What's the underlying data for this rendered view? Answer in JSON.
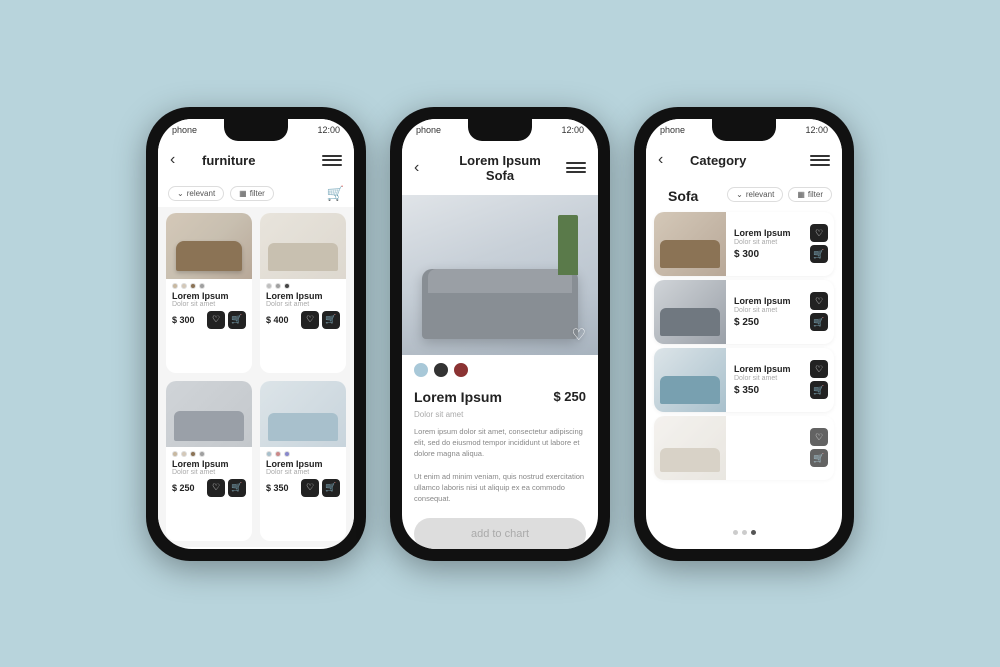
{
  "background": "#b8d4dc",
  "phones": [
    {
      "id": "phone-1",
      "status": {
        "left": "phone",
        "right": "12:00"
      },
      "nav": {
        "title": "furniture",
        "has_back": true,
        "has_menu": true,
        "has_cart": true
      },
      "filters": [
        "relevant",
        "filter"
      ],
      "products": [
        {
          "id": "p1",
          "name": "Lorem Ipsum",
          "sub": "Dolor sit amet",
          "price": "$ 300",
          "colors": [
            "#c8b8a0",
            "#d4c8b8",
            "#8B7355",
            "#a0a0a0"
          ],
          "img_style": "sofa-img-1"
        },
        {
          "id": "p2",
          "name": "Lorem Ipsum",
          "sub": "Dolor sit amet",
          "price": "$ 400",
          "colors": [
            "#c0c0c0",
            "#a0a0a0",
            "#444444"
          ],
          "img_style": "sofa-img-2"
        },
        {
          "id": "p3",
          "name": "Lorem Ipsum",
          "sub": "Dolor sit amet",
          "price": "$ 250",
          "colors": [
            "#c8b8a0",
            "#d4c8b8",
            "#8B7355",
            "#a0a0a0"
          ],
          "img_style": "sofa-img-3"
        },
        {
          "id": "p4",
          "name": "Lorem Ipsum",
          "sub": "Dolor sit amet",
          "price": "$ 350",
          "colors": [
            "#a8c0cc",
            "#cc8888",
            "#8888cc"
          ],
          "img_style": "sofa-img-4"
        }
      ]
    },
    {
      "id": "phone-2",
      "status": {
        "left": "phone",
        "right": "12:00"
      },
      "nav": {
        "title": "Lorem Ipsum Sofa",
        "has_back": true,
        "has_menu": true
      },
      "detail": {
        "colors": [
          {
            "hex": "#a8c8d8",
            "active": false
          },
          {
            "hex": "#333333",
            "active": true
          },
          {
            "hex": "#8B3333",
            "active": false
          }
        ],
        "title": "Lorem Ipsum",
        "price": "$ 250",
        "sub": "Dolor sit amet",
        "description": "Lorem ipsum dolor sit amet, consectetur adipiscing elit, sed do eiusmod tempor incididunt ut labore et dolore magna aliqua.\n\nUt enim ad minim veniam, quis nostrud exercitation ullamco laboris nisi ut aliquip ex ea commodo consequat.",
        "cta": "add to chart"
      }
    },
    {
      "id": "phone-3",
      "status": {
        "left": "phone",
        "right": "12:00"
      },
      "nav": {
        "title": "Category",
        "has_back": true,
        "has_menu": true
      },
      "filters": [
        "relevant",
        "filter"
      ],
      "category_label": "Sofa",
      "products": [
        {
          "id": "cp1",
          "name": "Lorem Ipsum",
          "sub": "Dolor sit amet",
          "price": "$ 300",
          "img_style": "sofa-list-1"
        },
        {
          "id": "cp2",
          "name": "Lorem Ipsum",
          "sub": "Dolor sit amet",
          "price": "$ 250",
          "img_style": "sofa-list-2"
        },
        {
          "id": "cp3",
          "name": "Lorem Ipsum",
          "sub": "Dolor sit amet",
          "price": "$ 350",
          "img_style": "sofa-list-3"
        },
        {
          "id": "cp4",
          "name": "",
          "sub": "",
          "price": "",
          "img_style": "sofa-list-4"
        }
      ],
      "scroll_dots": [
        false,
        false,
        true
      ]
    }
  ]
}
